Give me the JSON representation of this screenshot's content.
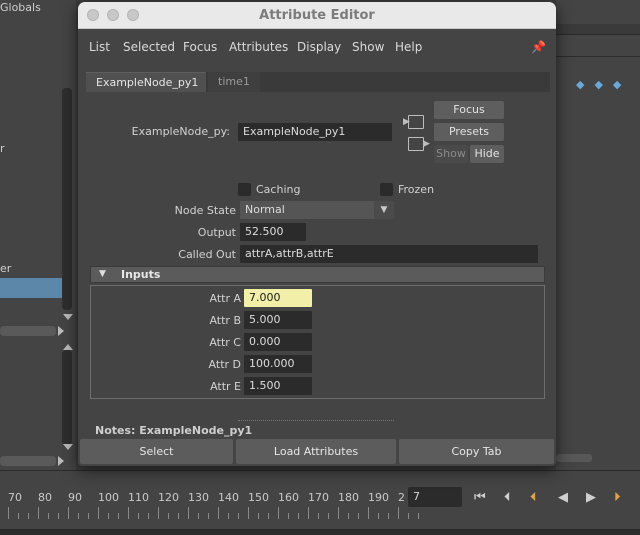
{
  "background": {
    "left_panel": {
      "globals_label": "Globals",
      "fragment_r": "r",
      "fragment_er": "er"
    },
    "right_panel": {},
    "timeline": {
      "ticks": [
        "70",
        "80",
        "90",
        "100",
        "110",
        "120",
        "130",
        "140",
        "150",
        "160",
        "170",
        "180",
        "190",
        "2"
      ],
      "current_frame": "7"
    }
  },
  "window": {
    "title": "Attribute Editor",
    "menu": [
      "List",
      "Selected",
      "Focus",
      "Attributes",
      "Display",
      "Show",
      "Help"
    ],
    "tabs": [
      "ExampleNode_py1",
      "time1"
    ],
    "node_label": "ExampleNode_py:",
    "node_name": "ExampleNode_py1",
    "buttons": {
      "focus": "Focus",
      "presets": "Presets",
      "show": "Show",
      "hide": "Hide"
    },
    "checks": {
      "caching": "Caching",
      "frozen": "Frozen"
    },
    "node_state": {
      "label": "Node State",
      "value": "Normal"
    },
    "output": {
      "label": "Output",
      "value": "52.500"
    },
    "called_out": {
      "label": "Called Out",
      "value": "attrA,attrB,attrE"
    },
    "section": {
      "title": "Inputs",
      "attrs": [
        {
          "label": "Attr A",
          "value": "7.000"
        },
        {
          "label": "Attr B",
          "value": "5.000"
        },
        {
          "label": "Attr C",
          "value": "0.000"
        },
        {
          "label": "Attr D",
          "value": "100.000"
        },
        {
          "label": "Attr E",
          "value": "1.500"
        }
      ]
    },
    "notes": "Notes:  ExampleNode_py1",
    "bottom_buttons": {
      "select": "Select",
      "load": "Load Attributes",
      "copy": "Copy Tab"
    }
  },
  "colors": {
    "highlight_field": "#f2f0a8",
    "selection": "#5d87a8",
    "key_icons": "#69a8d8"
  }
}
